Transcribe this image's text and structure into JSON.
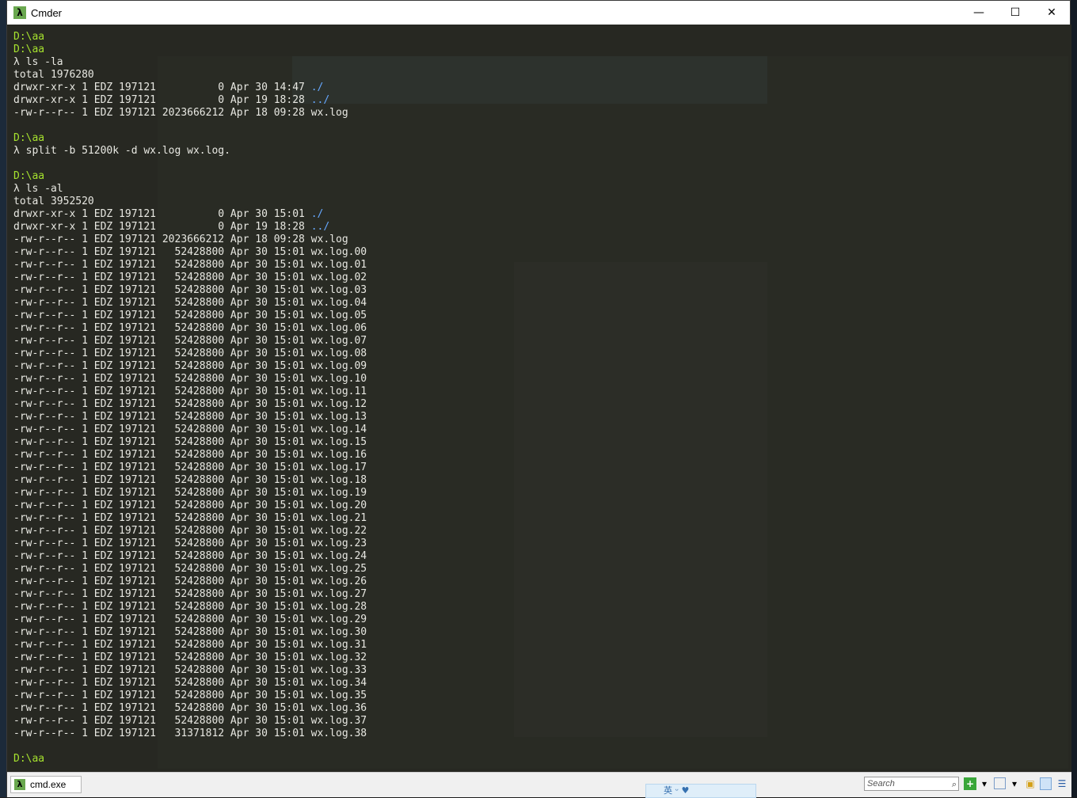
{
  "window": {
    "title": "Cmder",
    "app_glyph": "λ"
  },
  "title_controls": {
    "minimize": "—",
    "maximize": "☐",
    "close": "✕"
  },
  "console": {
    "lines": [
      [
        {
          "t": "D:\\aa",
          "c": "path"
        }
      ],
      [
        {
          "t": "D:\\aa",
          "c": "path"
        }
      ],
      [
        {
          "t": "λ ls -la"
        }
      ],
      [
        {
          "t": "total 1976280"
        }
      ],
      [
        {
          "t": "drwxr-xr-x 1 EDZ 197121          0 Apr 30 14:47 "
        },
        {
          "t": "./",
          "c": "dir"
        }
      ],
      [
        {
          "t": "drwxr-xr-x 1 EDZ 197121          0 Apr 19 18:28 "
        },
        {
          "t": "../",
          "c": "dir"
        }
      ],
      [
        {
          "t": "-rw-r--r-- 1 EDZ 197121 2023666212 Apr 18 09:28 wx.log"
        }
      ],
      [
        {
          "t": ""
        }
      ],
      [
        {
          "t": "D:\\aa",
          "c": "path"
        }
      ],
      [
        {
          "t": "λ split -b 51200k -d wx.log wx.log."
        }
      ],
      [
        {
          "t": ""
        }
      ],
      [
        {
          "t": "D:\\aa",
          "c": "path"
        }
      ],
      [
        {
          "t": "λ ls -al"
        }
      ],
      [
        {
          "t": "total 3952520"
        }
      ],
      [
        {
          "t": "drwxr-xr-x 1 EDZ 197121          0 Apr 30 15:01 "
        },
        {
          "t": "./",
          "c": "dir"
        }
      ],
      [
        {
          "t": "drwxr-xr-x 1 EDZ 197121          0 Apr 19 18:28 "
        },
        {
          "t": "../",
          "c": "dir"
        }
      ],
      [
        {
          "t": "-rw-r--r-- 1 EDZ 197121 2023666212 Apr 18 09:28 wx.log"
        }
      ],
      [
        {
          "t": "-rw-r--r-- 1 EDZ 197121   52428800 Apr 30 15:01 wx.log.00"
        }
      ],
      [
        {
          "t": "-rw-r--r-- 1 EDZ 197121   52428800 Apr 30 15:01 wx.log.01"
        }
      ],
      [
        {
          "t": "-rw-r--r-- 1 EDZ 197121   52428800 Apr 30 15:01 wx.log.02"
        }
      ],
      [
        {
          "t": "-rw-r--r-- 1 EDZ 197121   52428800 Apr 30 15:01 wx.log.03"
        }
      ],
      [
        {
          "t": "-rw-r--r-- 1 EDZ 197121   52428800 Apr 30 15:01 wx.log.04"
        }
      ],
      [
        {
          "t": "-rw-r--r-- 1 EDZ 197121   52428800 Apr 30 15:01 wx.log.05"
        }
      ],
      [
        {
          "t": "-rw-r--r-- 1 EDZ 197121   52428800 Apr 30 15:01 wx.log.06"
        }
      ],
      [
        {
          "t": "-rw-r--r-- 1 EDZ 197121   52428800 Apr 30 15:01 wx.log.07"
        }
      ],
      [
        {
          "t": "-rw-r--r-- 1 EDZ 197121   52428800 Apr 30 15:01 wx.log.08"
        }
      ],
      [
        {
          "t": "-rw-r--r-- 1 EDZ 197121   52428800 Apr 30 15:01 wx.log.09"
        }
      ],
      [
        {
          "t": "-rw-r--r-- 1 EDZ 197121   52428800 Apr 30 15:01 wx.log.10"
        }
      ],
      [
        {
          "t": "-rw-r--r-- 1 EDZ 197121   52428800 Apr 30 15:01 wx.log.11"
        }
      ],
      [
        {
          "t": "-rw-r--r-- 1 EDZ 197121   52428800 Apr 30 15:01 wx.log.12"
        }
      ],
      [
        {
          "t": "-rw-r--r-- 1 EDZ 197121   52428800 Apr 30 15:01 wx.log.13"
        }
      ],
      [
        {
          "t": "-rw-r--r-- 1 EDZ 197121   52428800 Apr 30 15:01 wx.log.14"
        }
      ],
      [
        {
          "t": "-rw-r--r-- 1 EDZ 197121   52428800 Apr 30 15:01 wx.log.15"
        }
      ],
      [
        {
          "t": "-rw-r--r-- 1 EDZ 197121   52428800 Apr 30 15:01 wx.log.16"
        }
      ],
      [
        {
          "t": "-rw-r--r-- 1 EDZ 197121   52428800 Apr 30 15:01 wx.log.17"
        }
      ],
      [
        {
          "t": "-rw-r--r-- 1 EDZ 197121   52428800 Apr 30 15:01 wx.log.18"
        }
      ],
      [
        {
          "t": "-rw-r--r-- 1 EDZ 197121   52428800 Apr 30 15:01 wx.log.19"
        }
      ],
      [
        {
          "t": "-rw-r--r-- 1 EDZ 197121   52428800 Apr 30 15:01 wx.log.20"
        }
      ],
      [
        {
          "t": "-rw-r--r-- 1 EDZ 197121   52428800 Apr 30 15:01 wx.log.21"
        }
      ],
      [
        {
          "t": "-rw-r--r-- 1 EDZ 197121   52428800 Apr 30 15:01 wx.log.22"
        }
      ],
      [
        {
          "t": "-rw-r--r-- 1 EDZ 197121   52428800 Apr 30 15:01 wx.log.23"
        }
      ],
      [
        {
          "t": "-rw-r--r-- 1 EDZ 197121   52428800 Apr 30 15:01 wx.log.24"
        }
      ],
      [
        {
          "t": "-rw-r--r-- 1 EDZ 197121   52428800 Apr 30 15:01 wx.log.25"
        }
      ],
      [
        {
          "t": "-rw-r--r-- 1 EDZ 197121   52428800 Apr 30 15:01 wx.log.26"
        }
      ],
      [
        {
          "t": "-rw-r--r-- 1 EDZ 197121   52428800 Apr 30 15:01 wx.log.27"
        }
      ],
      [
        {
          "t": "-rw-r--r-- 1 EDZ 197121   52428800 Apr 30 15:01 wx.log.28"
        }
      ],
      [
        {
          "t": "-rw-r--r-- 1 EDZ 197121   52428800 Apr 30 15:01 wx.log.29"
        }
      ],
      [
        {
          "t": "-rw-r--r-- 1 EDZ 197121   52428800 Apr 30 15:01 wx.log.30"
        }
      ],
      [
        {
          "t": "-rw-r--r-- 1 EDZ 197121   52428800 Apr 30 15:01 wx.log.31"
        }
      ],
      [
        {
          "t": "-rw-r--r-- 1 EDZ 197121   52428800 Apr 30 15:01 wx.log.32"
        }
      ],
      [
        {
          "t": "-rw-r--r-- 1 EDZ 197121   52428800 Apr 30 15:01 wx.log.33"
        }
      ],
      [
        {
          "t": "-rw-r--r-- 1 EDZ 197121   52428800 Apr 30 15:01 wx.log.34"
        }
      ],
      [
        {
          "t": "-rw-r--r-- 1 EDZ 197121   52428800 Apr 30 15:01 wx.log.35"
        }
      ],
      [
        {
          "t": "-rw-r--r-- 1 EDZ 197121   52428800 Apr 30 15:01 wx.log.36"
        }
      ],
      [
        {
          "t": "-rw-r--r-- 1 EDZ 197121   52428800 Apr 30 15:01 wx.log.37"
        }
      ],
      [
        {
          "t": "-rw-r--r-- 1 EDZ 197121   31371812 Apr 30 15:01 wx.log.38"
        }
      ],
      [
        {
          "t": ""
        }
      ],
      [
        {
          "t": "D:\\aa",
          "c": "path"
        }
      ]
    ]
  },
  "statusbar": {
    "tab_label": "cmd.exe",
    "tab_glyph": "λ",
    "search_placeholder": "Search",
    "search_icon": "⌕",
    "ime_text": "英 ᵕ ♥"
  },
  "colors": {
    "background": "#272822",
    "text": "#e8e8e2",
    "path": "#a6e22e",
    "dir_link": "#66a8ff",
    "app_icon": "#6aa84f"
  }
}
